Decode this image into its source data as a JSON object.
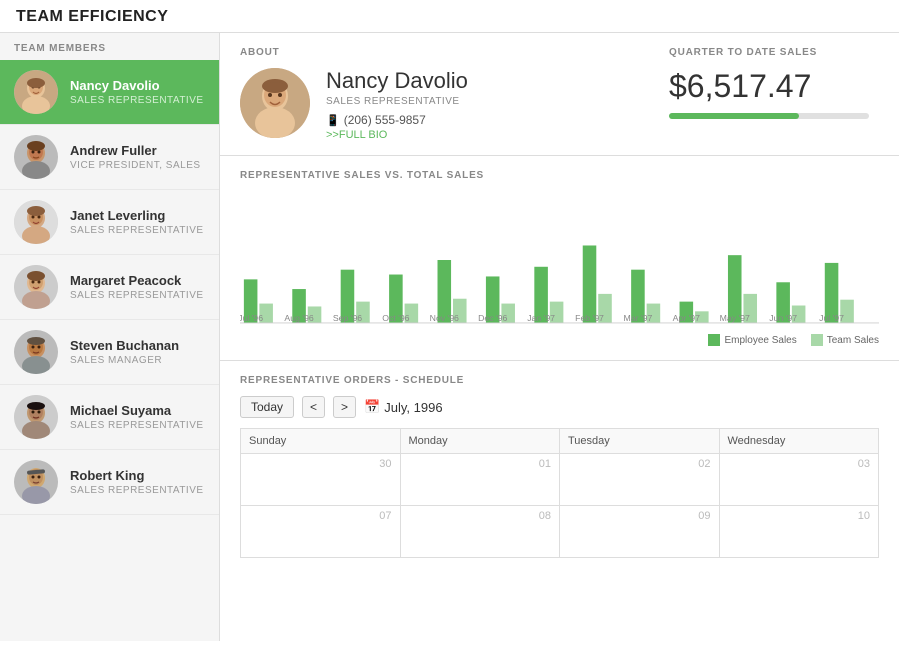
{
  "app": {
    "title": "TEAM EFFICIENCY"
  },
  "sidebar": {
    "header": "TEAM MEMBERS",
    "members": [
      {
        "id": 1,
        "name": "Nancy Davolio",
        "role": "SALES REPRESENTATIVE",
        "active": true,
        "color": "#a8d060"
      },
      {
        "id": 2,
        "name": "Andrew Fuller",
        "role": "VICE PRESIDENT, SALES",
        "active": false,
        "color": "#999"
      },
      {
        "id": 3,
        "name": "Janet Leverling",
        "role": "SALES REPRESENTATIVE",
        "active": false,
        "color": "#999"
      },
      {
        "id": 4,
        "name": "Margaret Peacock",
        "role": "SALES REPRESENTATIVE",
        "active": false,
        "color": "#999"
      },
      {
        "id": 5,
        "name": "Steven Buchanan",
        "role": "SALES MANAGER",
        "active": false,
        "color": "#999"
      },
      {
        "id": 6,
        "name": "Michael Suyama",
        "role": "SALES REPRESENTATIVE",
        "active": false,
        "color": "#999"
      },
      {
        "id": 7,
        "name": "Robert King",
        "role": "SALES REPRESENTATIVE",
        "active": false,
        "color": "#999"
      }
    ]
  },
  "about": {
    "label": "ABOUT",
    "name": "Nancy Davolio",
    "role": "SALES REPRESENTATIVE",
    "phone": "(206) 555-9857",
    "bio_link": ">>FULL BIO"
  },
  "qtd": {
    "label": "QUARTER TO DATE SALES",
    "amount": "$6,517.47",
    "bar_percent": 65
  },
  "chart": {
    "title": "REPRESENTATIVE SALES VS. TOTAL SALES",
    "legend": {
      "employee": "Employee Sales",
      "team": "Team Sales"
    },
    "bars": [
      {
        "label": "Jul '96",
        "employee": 45,
        "team": 10
      },
      {
        "label": "Aug '96",
        "employee": 30,
        "team": 8
      },
      {
        "label": "Sep '96",
        "employee": 55,
        "team": 12
      },
      {
        "label": "Oct '96",
        "employee": 50,
        "team": 10
      },
      {
        "label": "Nov '96",
        "employee": 65,
        "team": 15
      },
      {
        "label": "Dec '96",
        "employee": 48,
        "team": 10
      },
      {
        "label": "Jan '97",
        "employee": 58,
        "team": 12
      },
      {
        "label": "Feb '97",
        "employee": 80,
        "team": 18
      },
      {
        "label": "Mar '97",
        "employee": 55,
        "team": 10
      },
      {
        "label": "Apr '97",
        "employee": 20,
        "team": 5
      },
      {
        "label": "May '97",
        "employee": 70,
        "team": 18
      },
      {
        "label": "Jun '97",
        "employee": 42,
        "team": 8
      },
      {
        "label": "Jul '97",
        "employee": 60,
        "team": 14
      }
    ]
  },
  "schedule": {
    "title": "REPRESENTATIVE ORDERS - SCHEDULE",
    "btn_today": "Today",
    "btn_prev": "<",
    "btn_next": ">",
    "month": "July, 1996",
    "columns": [
      "Sunday",
      "Monday",
      "Tuesday",
      "Wednesday"
    ],
    "rows": [
      {
        "days": [
          "30",
          "01",
          "02",
          "03"
        ]
      },
      {
        "days": [
          "07",
          "08",
          "09",
          "10"
        ]
      }
    ]
  }
}
